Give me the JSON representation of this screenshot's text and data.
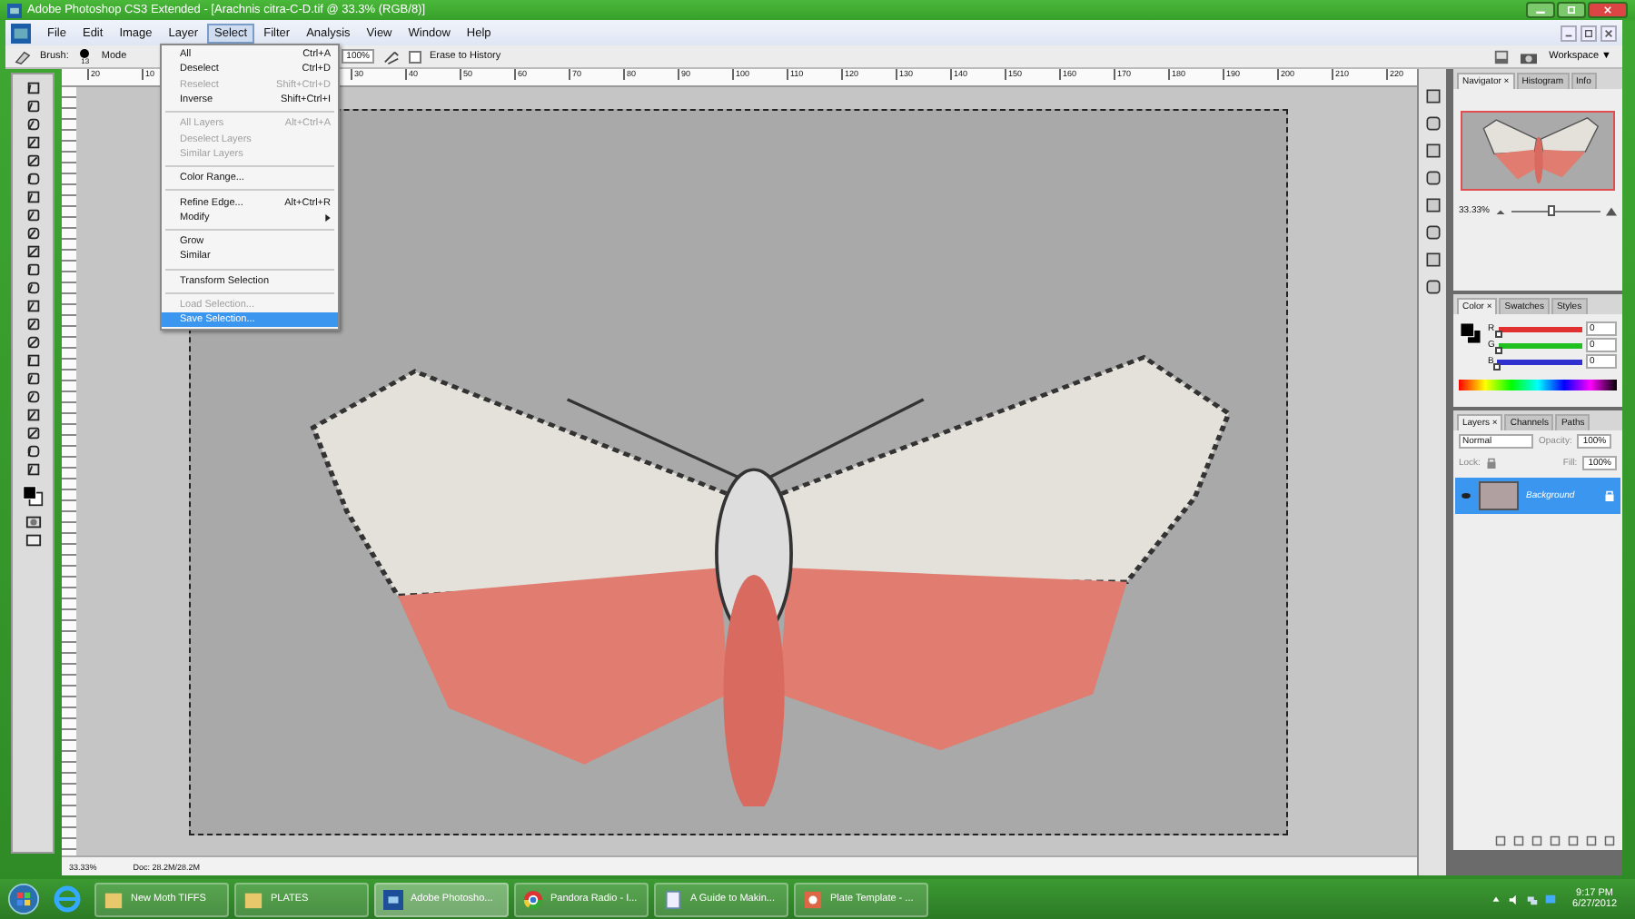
{
  "window": {
    "title": "Adobe Photoshop CS3 Extended - [Arachnis citra-C-D.tif @ 33.3% (RGB/8)]"
  },
  "menu_bar": [
    {
      "label": "File",
      "selected": false
    },
    {
      "label": "Edit",
      "selected": false
    },
    {
      "label": "Image",
      "selected": false
    },
    {
      "label": "Layer",
      "selected": false
    },
    {
      "label": "Select",
      "selected": true
    },
    {
      "label": "Filter",
      "selected": false
    },
    {
      "label": "Analysis",
      "selected": false
    },
    {
      "label": "View",
      "selected": false
    },
    {
      "label": "Window",
      "selected": false
    },
    {
      "label": "Help",
      "selected": false
    }
  ],
  "options_bar": {
    "brush_label": "Brush:",
    "brush_size": "13",
    "mode_label": "Mode",
    "opacity": "100%",
    "erase_to_history": {
      "label": "Erase to History",
      "checked": false
    },
    "workspace": "Workspace ▼"
  },
  "ruler": {
    "left_labels": [
      "20",
      "10"
    ],
    "labels": [
      "30",
      "40",
      "50",
      "60",
      "70",
      "80",
      "90",
      "100",
      "110",
      "120",
      "130",
      "140",
      "150",
      "160",
      "170",
      "180",
      "190",
      "200",
      "210",
      "220"
    ]
  },
  "select_menu": [
    {
      "kind": "item",
      "label": "All",
      "shortcut": "Ctrl+A",
      "disabled": false,
      "selected": false
    },
    {
      "kind": "item",
      "label": "Deselect",
      "shortcut": "Ctrl+D",
      "disabled": false,
      "selected": false
    },
    {
      "kind": "item",
      "label": "Reselect",
      "shortcut": "Shift+Ctrl+D",
      "disabled": true,
      "selected": false
    },
    {
      "kind": "item",
      "label": "Inverse",
      "shortcut": "Shift+Ctrl+I",
      "disabled": false,
      "selected": false
    },
    {
      "kind": "separator"
    },
    {
      "kind": "item",
      "label": "All Layers",
      "shortcut": "Alt+Ctrl+A",
      "disabled": true,
      "selected": false
    },
    {
      "kind": "item",
      "label": "Deselect Layers",
      "disabled": true,
      "selected": false
    },
    {
      "kind": "item",
      "label": "Similar Layers",
      "disabled": true,
      "selected": false
    },
    {
      "kind": "separator"
    },
    {
      "kind": "item",
      "label": "Color Range...",
      "disabled": false,
      "selected": false
    },
    {
      "kind": "separator"
    },
    {
      "kind": "item",
      "label": "Refine Edge...",
      "shortcut": "Alt+Ctrl+R",
      "disabled": false,
      "selected": false
    },
    {
      "kind": "submenu",
      "label": "Modify",
      "disabled": false,
      "selected": false
    },
    {
      "kind": "separator"
    },
    {
      "kind": "item",
      "label": "Grow",
      "disabled": false,
      "selected": false
    },
    {
      "kind": "item",
      "label": "Similar",
      "disabled": false,
      "selected": false
    },
    {
      "kind": "separator"
    },
    {
      "kind": "item",
      "label": "Transform Selection",
      "disabled": false,
      "selected": false
    },
    {
      "kind": "separator"
    },
    {
      "kind": "item",
      "label": "Load Selection...",
      "disabled": true,
      "selected": false
    },
    {
      "kind": "item",
      "label": "Save Selection...",
      "disabled": false,
      "selected": true
    }
  ],
  "status_bar": {
    "zoom": "33.33%",
    "doc": "Doc: 28.2M/28.2M"
  },
  "navigator": {
    "tabs": [
      {
        "label": "Navigator ×",
        "selected": true
      },
      {
        "label": "Histogram",
        "selected": false
      },
      {
        "label": "Info",
        "selected": false
      }
    ],
    "zoom": "33.33%",
    "level": 0.45
  },
  "color_panel": {
    "tabs": [
      {
        "label": "Color ×",
        "selected": true
      },
      {
        "label": "Swatches",
        "selected": false
      },
      {
        "label": "Styles",
        "selected": false
      }
    ],
    "channels": [
      {
        "name": "R",
        "value": "0",
        "level": 0,
        "color": "#e03030"
      },
      {
        "name": "G",
        "value": "0",
        "level": 0,
        "color": "#20c020"
      },
      {
        "name": "B",
        "value": "0",
        "level": 0,
        "color": "#3030d0"
      }
    ]
  },
  "layers_panel": {
    "tabs": [
      {
        "label": "Layers ×",
        "selected": true
      },
      {
        "label": "Channels",
        "selected": false
      },
      {
        "label": "Paths",
        "selected": false
      }
    ],
    "blend_mode": "Normal",
    "opacity_label": "Opacity:",
    "opacity": "100%",
    "lock_label": "Lock:",
    "fill_label": "Fill:",
    "fill": "100%",
    "layers": [
      {
        "name": "Background",
        "visible": true,
        "selected": true,
        "locked": true
      }
    ]
  },
  "taskbar": {
    "items": [
      {
        "label": "New Moth TIFFS",
        "kind": "folder",
        "selected": false
      },
      {
        "label": "PLATES",
        "kind": "folder",
        "selected": false
      },
      {
        "label": "Adobe Photosho...",
        "kind": "photoshop",
        "selected": true
      },
      {
        "label": "Pandora Radio - I...",
        "kind": "chrome",
        "selected": false
      },
      {
        "label": "A Guide to Makin...",
        "kind": "document",
        "selected": false
      },
      {
        "label": "Plate Template - ...",
        "kind": "powerpoint",
        "selected": false
      }
    ],
    "time": "9:17 PM",
    "date": "6/27/2012"
  }
}
